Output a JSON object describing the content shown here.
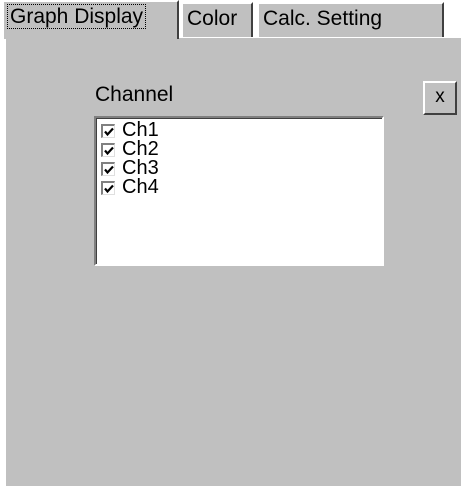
{
  "tabs": [
    {
      "label": "Graph Display",
      "active": true
    },
    {
      "label": "Color",
      "active": false
    },
    {
      "label": "Calc. Setting",
      "active": false
    }
  ],
  "channel_section": {
    "label": "Channel",
    "close_label": "x",
    "items": [
      {
        "label": "Ch1",
        "checked": true
      },
      {
        "label": "Ch2",
        "checked": true
      },
      {
        "label": "Ch3",
        "checked": true
      },
      {
        "label": "Ch4",
        "checked": true
      }
    ]
  },
  "colors": {
    "panel": "#c0c0c0",
    "list_background": "#ffffff"
  },
  "icons": {
    "checkbox": "checkmark-icon"
  }
}
